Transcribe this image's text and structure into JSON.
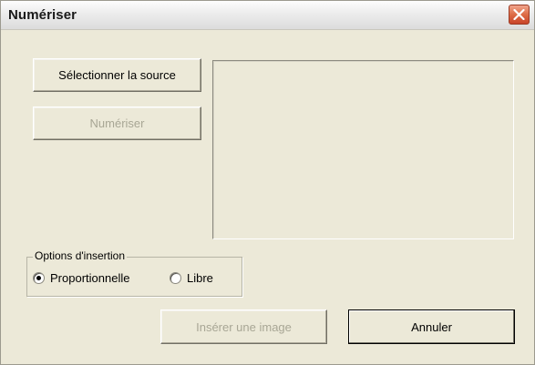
{
  "window": {
    "title": "Numériser"
  },
  "buttons": {
    "select_source": "Sélectionner la source",
    "scan": "Numériser",
    "insert_image": "Insérer une image",
    "cancel": "Annuler"
  },
  "insert_options": {
    "legend": "Options d'insertion",
    "options": [
      {
        "label": "Proportionnelle",
        "checked": true
      },
      {
        "label": "Libre",
        "checked": false
      }
    ]
  },
  "icons": {
    "close": "close-icon"
  },
  "colors": {
    "dialog_bg": "#ece9d8",
    "close_button": "#dd6c45",
    "disabled_text": "#a8a695"
  }
}
